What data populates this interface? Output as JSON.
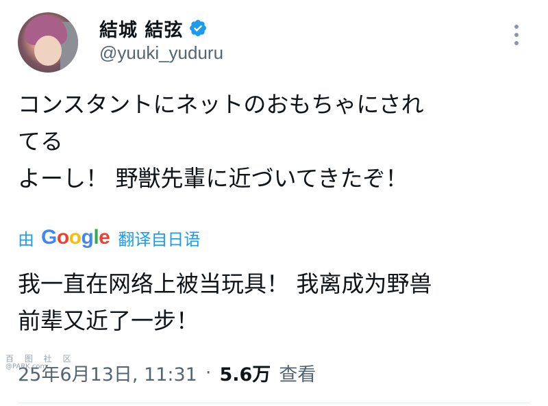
{
  "user": {
    "display_name": "結城 結弦",
    "handle": "@yuuki_yuduru",
    "verified": true,
    "verified_color": "#1d9bf0"
  },
  "tweet": {
    "original_lines": [
      "コンスタントにネットのおもちゃにされ",
      "てる",
      "よーし！ 野獣先輩に近づいてきたぞ！"
    ],
    "translate": {
      "by_label": "由",
      "provider": "Google",
      "from_label": "翻译自日语"
    },
    "translated_lines": [
      "我一直在网络上被当玩具！ 我离成为野兽",
      "前辈又近了一步！"
    ],
    "timestamp": "25年6月13日, 11:31",
    "separator": "·",
    "views_count": "5.6万",
    "views_label": "查看"
  },
  "watermark": {
    "line1": "百 图 社 区",
    "line2": "@PARK.com"
  },
  "icons": {
    "more": "more-vertical-icon",
    "verified": "verified-badge-icon"
  },
  "colors": {
    "link_blue": "#1d9bf0",
    "text_primary": "#0f1419",
    "text_secondary": "#536471"
  }
}
